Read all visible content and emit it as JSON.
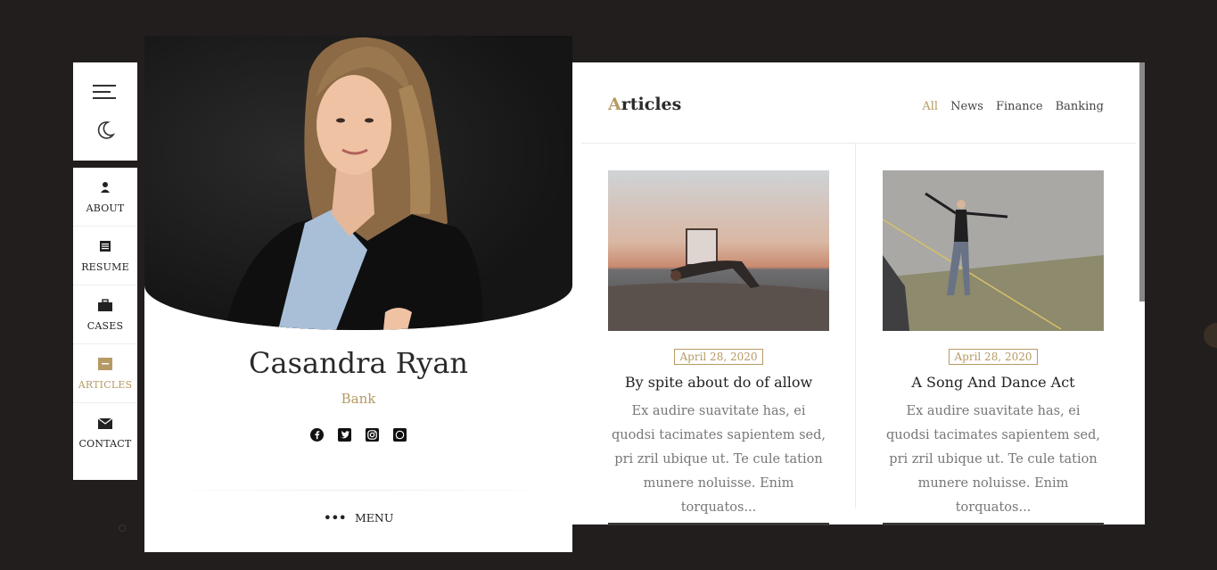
{
  "nav": {
    "items": [
      {
        "label": "ABOUT",
        "icon": "user-icon"
      },
      {
        "label": "RESUME",
        "icon": "list-icon"
      },
      {
        "label": "CASES",
        "icon": "briefcase-icon"
      },
      {
        "label": "ARTICLES",
        "icon": "article-icon"
      },
      {
        "label": "CONTACT",
        "icon": "envelope-icon"
      }
    ],
    "active": "ARTICLES"
  },
  "profile": {
    "name": "Casandra Ryan",
    "role": "Bank",
    "socials": [
      "facebook-icon",
      "twitter-icon",
      "instagram-icon",
      "whatsapp-icon"
    ],
    "menu_label": "MENU"
  },
  "articles": {
    "title_first": "A",
    "title_rest": "rticles",
    "filters": [
      "All",
      "News",
      "Finance",
      "Banking"
    ],
    "active_filter": "All",
    "posts": [
      {
        "date": "April 28, 2020",
        "title": "By spite about do of allow",
        "excerpt": "Ex audire suavitate has, ei quodsi tacimates sapientem sed, pri zril ubique ut. Te cule tation munere noluisse. Enim torquatos..."
      },
      {
        "date": "April 28, 2020",
        "title": "A Song And Dance Act",
        "excerpt": "Ex audire suavitate has, ei quodsi tacimates sapientem sed, pri zril ubique ut. Te cule tation munere noluisse. Enim torquatos..."
      }
    ]
  },
  "colors": {
    "accent": "#b59a64",
    "background": "#221e1e"
  }
}
